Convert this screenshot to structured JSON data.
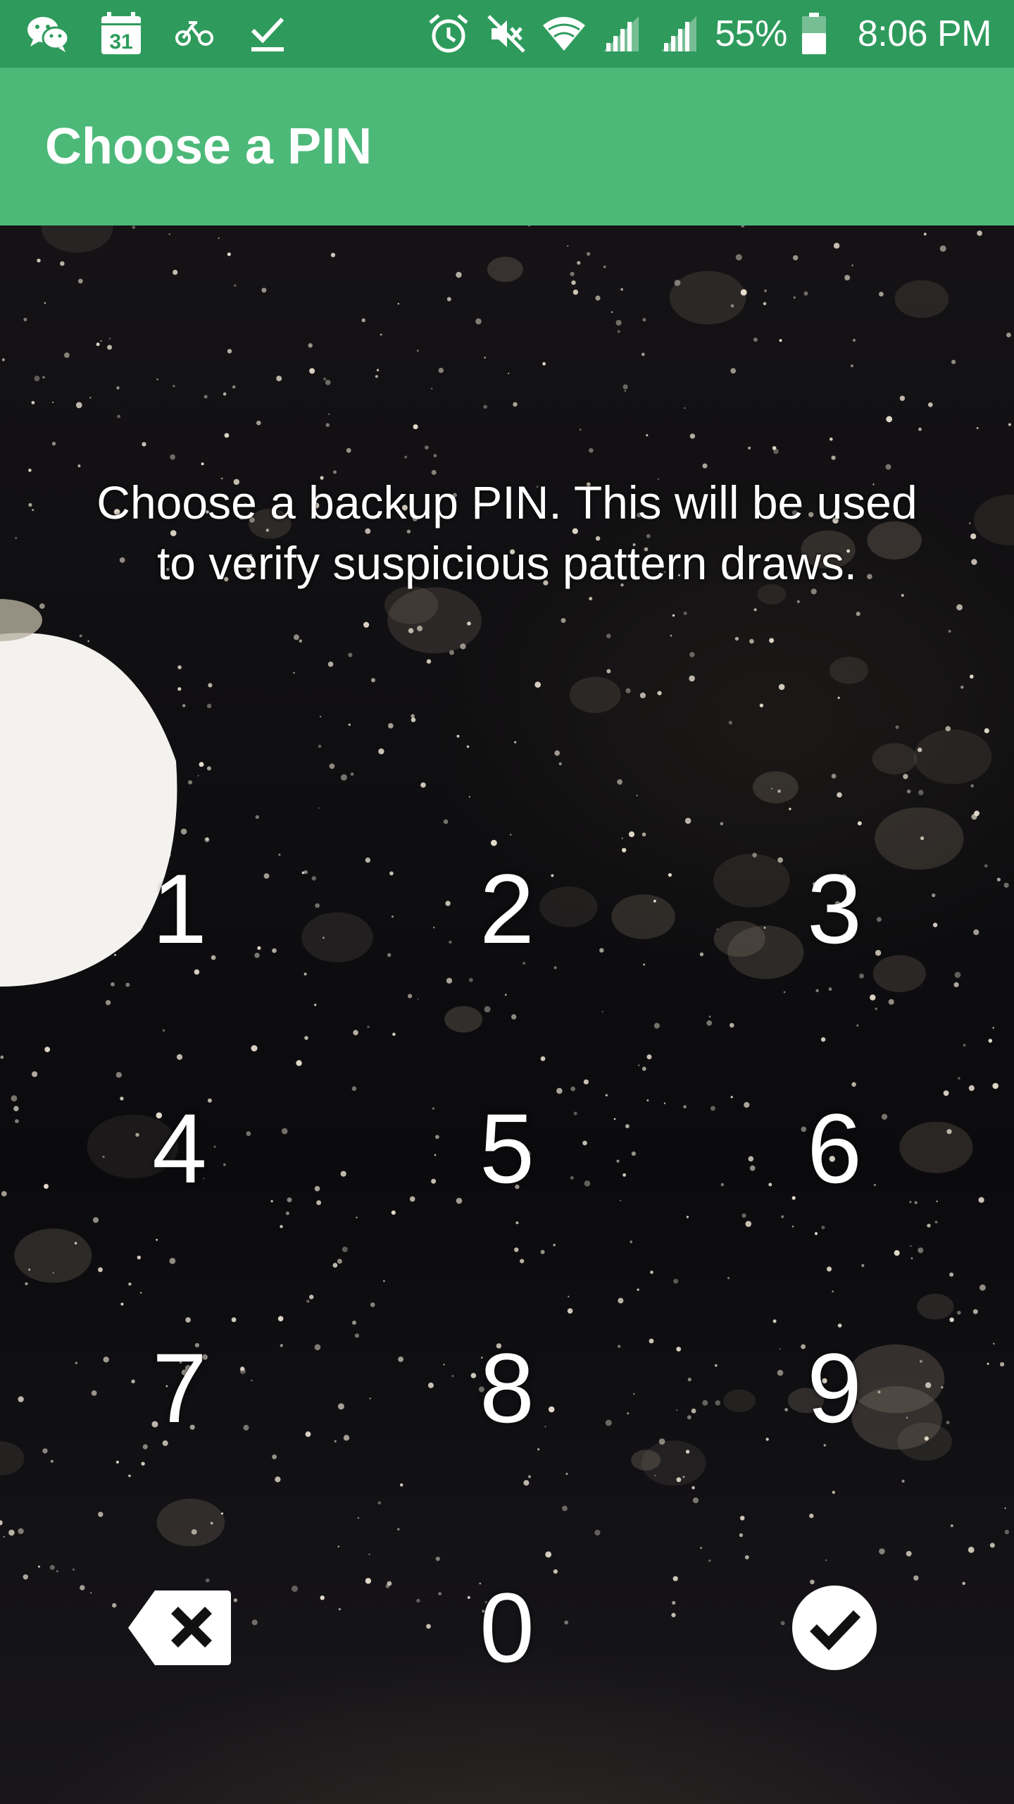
{
  "status_bar": {
    "left_icons": [
      "wechat-icon",
      "calendar-icon",
      "bike-icon",
      "checkmark-icon"
    ],
    "calendar_day": "31",
    "right_icons": [
      "alarm-icon",
      "mute-icon",
      "wifi-icon",
      "signal-icon",
      "signal-icon",
      "battery-icon"
    ],
    "battery_percent": "55%",
    "time": "8:06 PM"
  },
  "app_bar": {
    "title": "Choose a PIN"
  },
  "instruction": {
    "line1": "Choose a backup PIN. This will be used",
    "line2": "to verify suspicious pattern draws."
  },
  "keypad": {
    "keys": [
      "1",
      "2",
      "3",
      "4",
      "5",
      "6",
      "7",
      "8",
      "9",
      "backspace-icon",
      "0",
      "confirm-check-icon"
    ],
    "zero": "0"
  },
  "colors": {
    "status_bar": "#2e9b5c",
    "app_bar": "#4cb979",
    "text": "#ffffff",
    "background": "#0b0b0d"
  }
}
